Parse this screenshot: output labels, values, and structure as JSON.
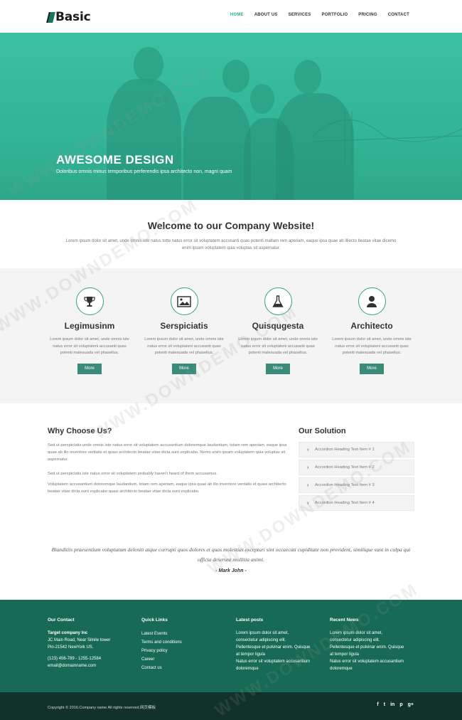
{
  "header": {
    "logo": "Basic",
    "nav": [
      "HOME",
      "ABOUT US",
      "SERVICES",
      "PORTFOLIO",
      "PRICING",
      "CONTACT"
    ],
    "active": "HOME"
  },
  "hero": {
    "title": "AWESOME DESIGN",
    "subtitle": "Doloribus omnis minus temporibus perferendis ipsa architecto non, magni quam"
  },
  "welcome": {
    "title": "Welcome to our Company Website!",
    "text": "Lorem ipsum dolor sit amet, unde omnis iste natus totte natus error sit voluptatem accusanti quas potenti maltam rem aperiam, eaque ipsa quae ab illiecto beatae vitae dicemo enim ipsam voluptatem quia voluptas sit aspernatur."
  },
  "features": [
    {
      "icon": "trophy-icon",
      "title": "Legimusinm",
      "text": "Lorem ipsum dolor sit amet, unde omnis iste natus error sit voluptateni accusanti quas potenti malesuada vel phasellus.",
      "button": "More"
    },
    {
      "icon": "image-icon",
      "title": "Serspiciatis",
      "text": "Lorem ipsum dolor sit amet, unde omnis iste natus error sit voluptateni accusanti quas potenti malesuada vel phasellus.",
      "button": "More"
    },
    {
      "icon": "flask-icon",
      "title": "Quisqugesta",
      "text": "Lorem ipsum dolor sit amet, unde omnis iste natus error sit voluptateni accusanti quas potenti malesuada vel phasellus.",
      "button": "More"
    },
    {
      "icon": "user-icon",
      "title": "Architecto",
      "text": "Lorem ipsum dolor sit amet, unde omnis iste natus error sit voluptateni accusanti quas potenti malesuada vel phasellus.",
      "button": "More"
    }
  ],
  "why": {
    "title": "Why Choose Us?",
    "p1": "Sed ut perspiciatis unde omnis iste natus error sit voluptatem accusantium doloremque laudantium, totam rem aperiam, eaque ipsa quae ab illo inventore veritatis et quasi architecto beatae vitae dicta sunt explicabo. Nemo enim ipsam voluptatem quia voluptas sit aspernatur.",
    "p2": "Sed ut perspiciatis iste natus error sit voluptatem probably haven't heard of them accusamus.",
    "p3": "Voluptatem accusantium doloremque laudantium, totam rem aperiam, eaque ipsa quae ab illo inventore veritatis et quasi architecto beatae vitae dicta sunt explicabo quasi architecto beatae vitae dicta sunt explicabo."
  },
  "solution": {
    "title": "Our Solution",
    "items": [
      "Accordion Heading Text Item # 1",
      "Accordion Heading Text Item # 2",
      "Accordion Heading Text Item # 3",
      "Accordion Heading Text Item # 4"
    ]
  },
  "quote": {
    "text": "Blanditiis praesentium voluptatum deleniti atque corrupti quos dolores et quas molestias excepturi sint occaecati cupiditate non provident, similique sunt in culpa qui officia deserunt mollitia animi.",
    "author": "- Mark John -"
  },
  "footer": {
    "contact": {
      "title": "Our Contact",
      "company": "Target company Inc",
      "address1": "JC Main Road, Near Silnile tower",
      "address2": "Pin-21542 NewYork US.",
      "phone": "(123) 456-789 - 1255-12584",
      "email": "email@domainname.com"
    },
    "quick": {
      "title": "Quick Links",
      "links": [
        "Latest Events",
        "Terms and conditions",
        "Privacy policy",
        "Career",
        "Contact us"
      ]
    },
    "posts": {
      "title": "Latest posts",
      "items": [
        "Lorem ipsum dolor sit amet,",
        "consectetur adipiscing elit.",
        "Pellentesque et pulvinar enim. Quisque",
        "at tempor ligula",
        "Natus error sit voluptatem accusantium",
        "doloremque"
      ]
    },
    "news": {
      "title": "Recent News",
      "items": [
        "Lorem ipsum dolor sit amet,",
        "consectetur adipiscing elit.",
        "Pellentesque et pulvinar enim. Quisque",
        "at tempor ligula",
        "Natus error sit voluptatem accusantium",
        "doloremque"
      ]
    }
  },
  "bottom": {
    "copyright": "Copyright © 2016.Company name All rights reserved.网页模板",
    "social": [
      "f",
      "t",
      "in",
      "p",
      "g+"
    ]
  },
  "watermark": "WWW.DOWNDEMO.COM"
}
